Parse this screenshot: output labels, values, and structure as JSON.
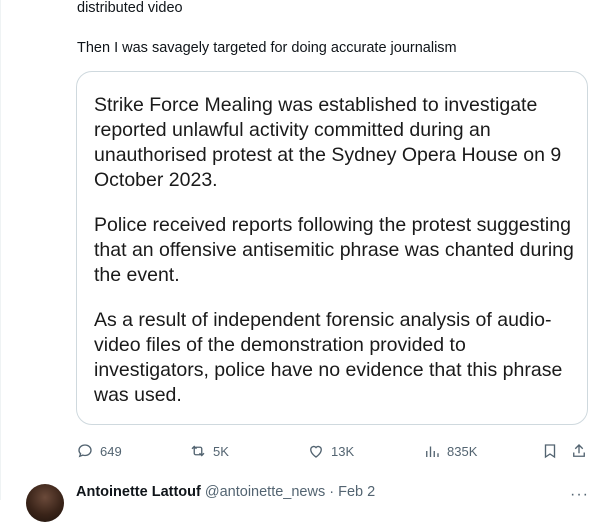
{
  "tweet": {
    "text_line1": "distributed video",
    "text_line2": "Then I was savagely targeted for doing accurate journalism"
  },
  "quote": {
    "paragraphs": [
      "Strike Force Mealing was established to investigate reported unlawful activity committed during an unauthorised protest at the Sydney Opera House on 9 October 2023.",
      "Police received reports following the protest suggesting that an offensive antisemitic phrase was chanted during the event.",
      "As a result of independent forensic analysis of audio-video files of the demonstration provided to investigators, police have no evidence that this phrase was used."
    ]
  },
  "actions": {
    "replies": "649",
    "retweets": "5K",
    "likes": "13K",
    "views": "835K",
    "reply_icon": "reply-icon",
    "retweet_icon": "retweet-icon",
    "like_icon": "heart-icon",
    "views_icon": "views-icon",
    "bookmark_icon": "bookmark-icon",
    "share_icon": "share-icon"
  },
  "next_tweet": {
    "display_name": "Antoinette Lattouf",
    "handle_date": "@antoinette_news · Feb 2",
    "more": "···"
  },
  "colors": {
    "text": "#0f1419",
    "secondary": "#536471",
    "border": "#cfd9de"
  }
}
